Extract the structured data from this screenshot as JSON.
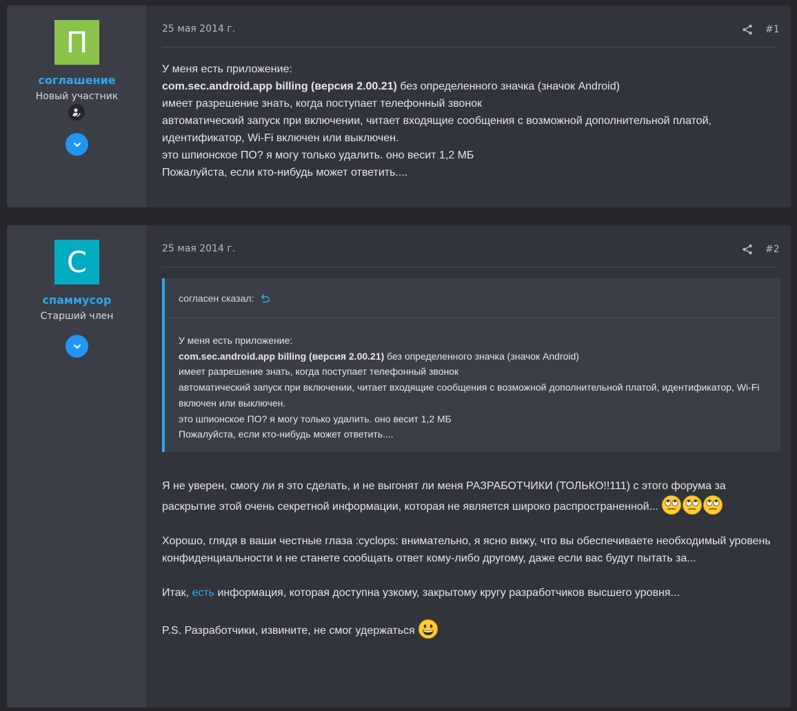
{
  "colors": {
    "page_bg": "#25272c",
    "post_bg": "#31343b",
    "user_panel_bg": "#3b3e46",
    "accent": "#2ea7ee",
    "avatar1": "#8bc34a",
    "avatar2": "#00acc1",
    "button_blue": "#2196f3"
  },
  "posts": [
    {
      "avatar_letter": "П",
      "username": "соглашение",
      "user_title": "Новый участник",
      "date": "25 мая 2014 г.",
      "number": "#1",
      "body": {
        "line1": "У меня есть приложение:",
        "line2_bold": "com.sec.android.app billing (версия 2.00.21)",
        "line2_rest": " без определенного значка (значок Android)",
        "line3": "имеет разрешение знать, когда поступает телефонный звонок",
        "line4": "автоматический запуск при включении, читает входящие сообщения с возможной дополнительной платой, идентификатор, Wi-Fi включен или выключен.",
        "line5": "это шпионское ПО? я могу только удалить. оно весит 1,2 МБ",
        "line6": "Пожалуйста, если кто-нибудь может ответить...."
      }
    },
    {
      "avatar_letter": "С",
      "username": "спаммусор",
      "user_title": "Старший член",
      "date": "25 мая 2014 г.",
      "number": "#2",
      "quote": {
        "author_line": "согласен сказал:",
        "line1": "У меня есть приложение:",
        "line2_bold": "com.sec.android.app billing (версия 2.00.21)",
        "line2_rest": " без определенного значка (значок Android)",
        "line3": "имеет разрешение знать, когда поступает телефонный звонок",
        "line4": "автоматический запуск при включении, читает входящие сообщения с возможной дополнительной платой, идентификатор, Wi-Fi включен или выключен.",
        "line5": "это шпионское ПО? я могу только удалить. оно весит 1,2 МБ",
        "line6": "Пожалуйста, если кто-нибудь может ответить...."
      },
      "body": {
        "p1": "Я не уверен, смогу ли я это сделать, и не выгонят ли меня РАЗРАБОТЧИКИ (ТОЛЬКО!!111) с этого форума за раскрытие этой очень секретной информации, которая не является широко распространенной...",
        "p2": "Хорошо, глядя в ваши честные глаза :cyclops: внимательно, я ясно вижу, что вы обеспечиваете необходимый уровень конфиденциальности и не станете сообщать ответ кому-либо другому, даже если вас будут пытать за...",
        "p3_before": "Итак, ",
        "p3_link": "есть",
        "p3_after": " информация, которая доступна узкому, закрытому кругу разработчиков высшего уровня...",
        "p4": "P.S. Разработчики, извините, не смог удержаться"
      }
    }
  ],
  "icons": {
    "share": "share-icon",
    "expand": "chevron-down-icon",
    "badge": "user-edit-icon",
    "quote_jump": "undo-arrow-icon",
    "eye_roll": "eye-roll-emoji",
    "grin": "grin-emoji"
  }
}
